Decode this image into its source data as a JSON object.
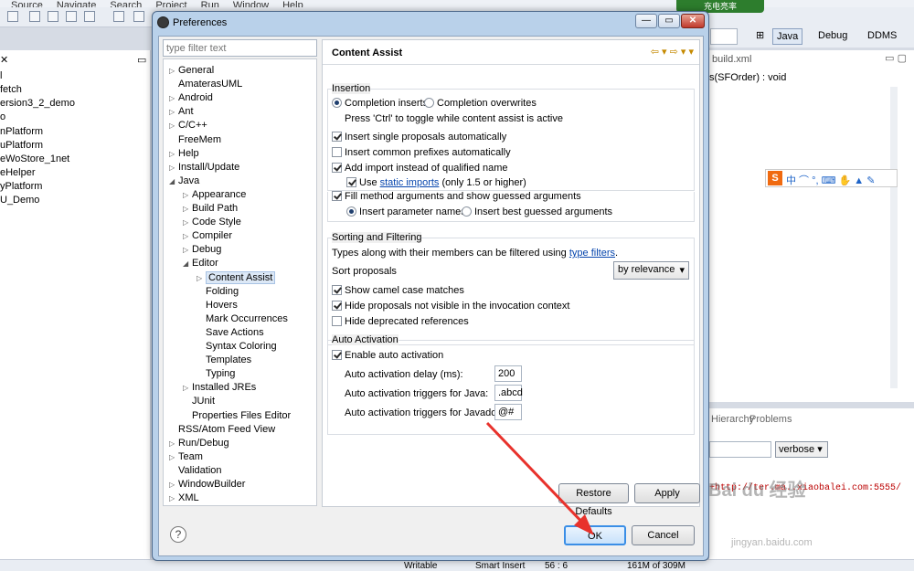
{
  "background": {
    "menu": [
      "Source",
      "Navigate",
      "Search",
      "Project",
      "Run",
      "Window",
      "Help"
    ],
    "charge_badge": "充电亮率",
    "perspectives": [
      "Java",
      "Debug",
      "DDMS"
    ],
    "left_items": [
      "l",
      "fetch",
      "ersion3_2_demo",
      "o",
      "nPlatform",
      "uPlatform",
      "eWoStore_1net",
      "eHelper",
      "yPlatform",
      "U_Demo"
    ],
    "editor_tab": "build.xml",
    "outline_text": "s(SFOrder) : void",
    "bottom_tabs": [
      "Hierarchy",
      "Problems"
    ],
    "verbose_label": "verbose",
    "console_line": "+http://ter.ma..xiaobalei.com:5555/",
    "status": {
      "writable": "Writable",
      "insert": "Smart Insert",
      "pos": "56 : 6",
      "mem": "161M of 309M"
    }
  },
  "dialog": {
    "title": "Preferences",
    "filter_placeholder": "type filter text",
    "tree": [
      {
        "label": "General",
        "indent": 0,
        "tw": "▷"
      },
      {
        "label": "AmaterasUML",
        "indent": 0,
        "tw": ""
      },
      {
        "label": "Android",
        "indent": 0,
        "tw": "▷"
      },
      {
        "label": "Ant",
        "indent": 0,
        "tw": "▷"
      },
      {
        "label": "C/C++",
        "indent": 0,
        "tw": "▷"
      },
      {
        "label": "FreeMem",
        "indent": 0,
        "tw": ""
      },
      {
        "label": "Help",
        "indent": 0,
        "tw": "▷"
      },
      {
        "label": "Install/Update",
        "indent": 0,
        "tw": "▷"
      },
      {
        "label": "Java",
        "indent": 0,
        "tw": "◢"
      },
      {
        "label": "Appearance",
        "indent": 1,
        "tw": "▷"
      },
      {
        "label": "Build Path",
        "indent": 1,
        "tw": "▷"
      },
      {
        "label": "Code Style",
        "indent": 1,
        "tw": "▷"
      },
      {
        "label": "Compiler",
        "indent": 1,
        "tw": "▷"
      },
      {
        "label": "Debug",
        "indent": 1,
        "tw": "▷"
      },
      {
        "label": "Editor",
        "indent": 1,
        "tw": "◢"
      },
      {
        "label": "Content Assist",
        "indent": 2,
        "tw": "▷",
        "selected": true
      },
      {
        "label": "Folding",
        "indent": 2,
        "tw": ""
      },
      {
        "label": "Hovers",
        "indent": 2,
        "tw": ""
      },
      {
        "label": "Mark Occurrences",
        "indent": 2,
        "tw": ""
      },
      {
        "label": "Save Actions",
        "indent": 2,
        "tw": ""
      },
      {
        "label": "Syntax Coloring",
        "indent": 2,
        "tw": ""
      },
      {
        "label": "Templates",
        "indent": 2,
        "tw": ""
      },
      {
        "label": "Typing",
        "indent": 2,
        "tw": ""
      },
      {
        "label": "Installed JREs",
        "indent": 1,
        "tw": "▷"
      },
      {
        "label": "JUnit",
        "indent": 1,
        "tw": ""
      },
      {
        "label": "Properties Files Editor",
        "indent": 1,
        "tw": ""
      },
      {
        "label": "RSS/Atom Feed View",
        "indent": 0,
        "tw": ""
      },
      {
        "label": "Run/Debug",
        "indent": 0,
        "tw": "▷"
      },
      {
        "label": "Team",
        "indent": 0,
        "tw": "▷"
      },
      {
        "label": "Validation",
        "indent": 0,
        "tw": ""
      },
      {
        "label": "WindowBuilder",
        "indent": 0,
        "tw": "▷"
      },
      {
        "label": "XML",
        "indent": 0,
        "tw": "▷"
      }
    ],
    "page_title": "Content Assist",
    "insertion": {
      "label": "Insertion",
      "completion_inserts": "Completion inserts",
      "completion_overwrites": "Completion overwrites",
      "toggle_hint": "Press 'Ctrl' to toggle while content assist is active",
      "insert_single": "Insert single proposals automatically",
      "insert_common": "Insert common prefixes automatically",
      "add_import": "Add import instead of qualified name",
      "use_prefix": "Use",
      "static_imports": "static imports",
      "use_suffix": "(only 1.5 or higher)",
      "fill_method": "Fill method arguments and show guessed arguments",
      "insert_param_names": "Insert parameter names",
      "insert_best_guessed": "Insert best guessed arguments"
    },
    "sorting": {
      "label": "Sorting and Filtering",
      "types_prefix": "Types along with their members can be filtered using",
      "type_filters": "type filters",
      "types_suffix": ".",
      "sort_label": "Sort proposals",
      "sort_value": "by relevance",
      "camel_case": "Show camel case matches",
      "hide_not_visible": "Hide proposals not visible in the invocation context",
      "hide_deprecated": "Hide deprecated references"
    },
    "auto_activation": {
      "label": "Auto Activation",
      "enable": "Enable auto activation",
      "delay_label": "Auto activation delay (ms):",
      "delay_value": "200",
      "java_label": "Auto activation triggers for Java:",
      "java_value": ".abcd",
      "javadoc_label": "Auto activation triggers for Javadoc:",
      "javadoc_value": "@#"
    },
    "restore_defaults": "Restore Defaults",
    "apply": "Apply",
    "ok": "OK",
    "cancel": "Cancel"
  },
  "overlay": {
    "ime_text": "S 中 ⌒ °, ⌨ ✋ 👕 🔧",
    "watermark": "Bai du 经验",
    "watermark_url": "jingyan.baidu.com"
  }
}
